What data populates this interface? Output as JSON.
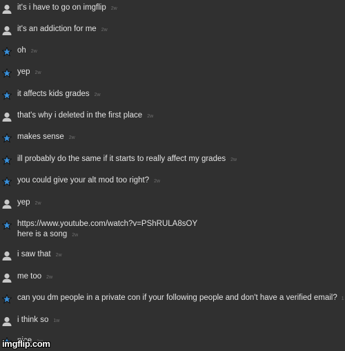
{
  "messages": [
    {
      "avatar": "user-avatar-icon",
      "text": "it's i have to go on imgflip",
      "time": "2w"
    },
    {
      "avatar": "user-avatar-icon",
      "text": "it's an addiction for me",
      "time": "2w"
    },
    {
      "avatar": "mod-star-icon",
      "text": "oh",
      "time": "2w"
    },
    {
      "avatar": "mod-star-icon",
      "text": "yep",
      "time": "2w"
    },
    {
      "avatar": "mod-star-icon",
      "text": "it affects kids grades",
      "time": "2w"
    },
    {
      "avatar": "user-avatar-icon",
      "text": "that's why i deleted in the first place",
      "time": "2w"
    },
    {
      "avatar": "mod-star-icon",
      "text": "makes sense",
      "time": "2w"
    },
    {
      "avatar": "mod-star-icon",
      "text": "ill probably do the same if it starts to really affect my grades",
      "time": "2w"
    },
    {
      "avatar": "mod-star-icon",
      "text": "you could give your alt mod too right?",
      "time": "2w"
    },
    {
      "avatar": "user-avatar-icon",
      "text": "yep",
      "time": "2w"
    },
    {
      "avatar": "mod-star-icon",
      "text": "https://www.youtube.com/watch?v=PShRULA8sOY",
      "text2": "here is a song",
      "time": "2w"
    },
    {
      "avatar": "user-avatar-icon",
      "text": "i saw that",
      "time": "2w"
    },
    {
      "avatar": "user-avatar-icon",
      "text": "me too",
      "time": "2w"
    },
    {
      "avatar": "mod-star-icon",
      "text": "can you dm people in a private con if your following people and don't have a verified email?",
      "time": "1"
    },
    {
      "avatar": "user-avatar-icon",
      "text": "i think so",
      "time": "1w"
    },
    {
      "avatar": "mod-star-icon",
      "text": "nice",
      "time": "1w"
    }
  ],
  "watermark": "imgflip.com",
  "colors": {
    "background": "#303030",
    "text": "#e4e4e4",
    "timestamp": "#707070",
    "star": "#3a8fd8",
    "avatar": "#c8c8c8"
  }
}
